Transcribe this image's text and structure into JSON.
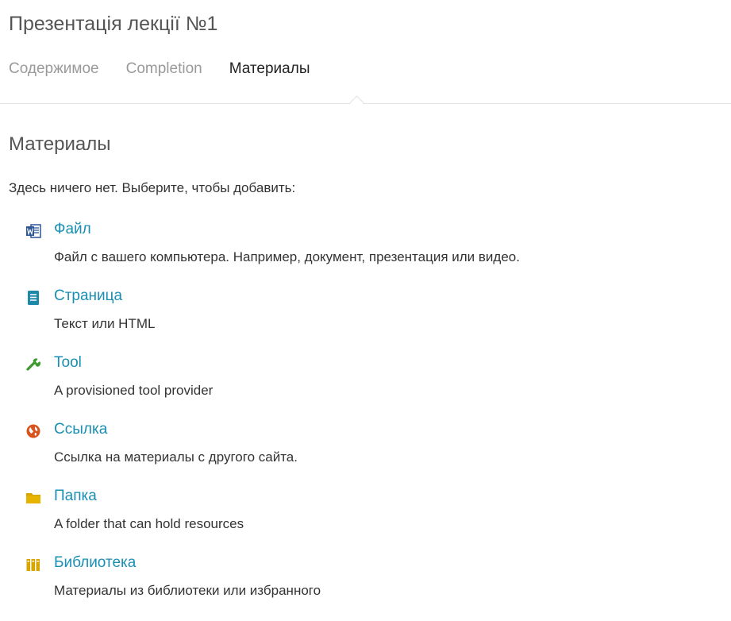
{
  "page": {
    "title": "Презентація лекції №1"
  },
  "tabs": [
    {
      "label": "Содержимое"
    },
    {
      "label": "Completion"
    },
    {
      "label": "Материалы"
    }
  ],
  "section": {
    "title": "Материалы",
    "intro": "Здесь ничего нет. Выберите, чтобы добавить:"
  },
  "options": [
    {
      "icon": "word-file-icon",
      "label": "Файл",
      "description": "Файл с вашего компьютера. Например, документ, презентация или видео."
    },
    {
      "icon": "page-icon",
      "label": "Страница",
      "description": "Текст или HTML"
    },
    {
      "icon": "wrench-icon",
      "label": "Tool",
      "description": "A provisioned tool provider"
    },
    {
      "icon": "globe-icon",
      "label": "Ссылка",
      "description": "Ссылка на материалы с другого сайта."
    },
    {
      "icon": "folder-icon",
      "label": "Папка",
      "description": "A folder that can hold resources"
    },
    {
      "icon": "library-icon",
      "label": "Библиотека",
      "description": "Материалы из библиотеки или избранного"
    }
  ],
  "colors": {
    "link": "#1a8fb3",
    "word_blue": "#2b5797",
    "page_blue": "#1e88a8",
    "wrench_green": "#3a9a2a",
    "globe_orange": "#d9531e",
    "folder_yellow": "#d9a600",
    "library_yellow": "#d9a600"
  }
}
